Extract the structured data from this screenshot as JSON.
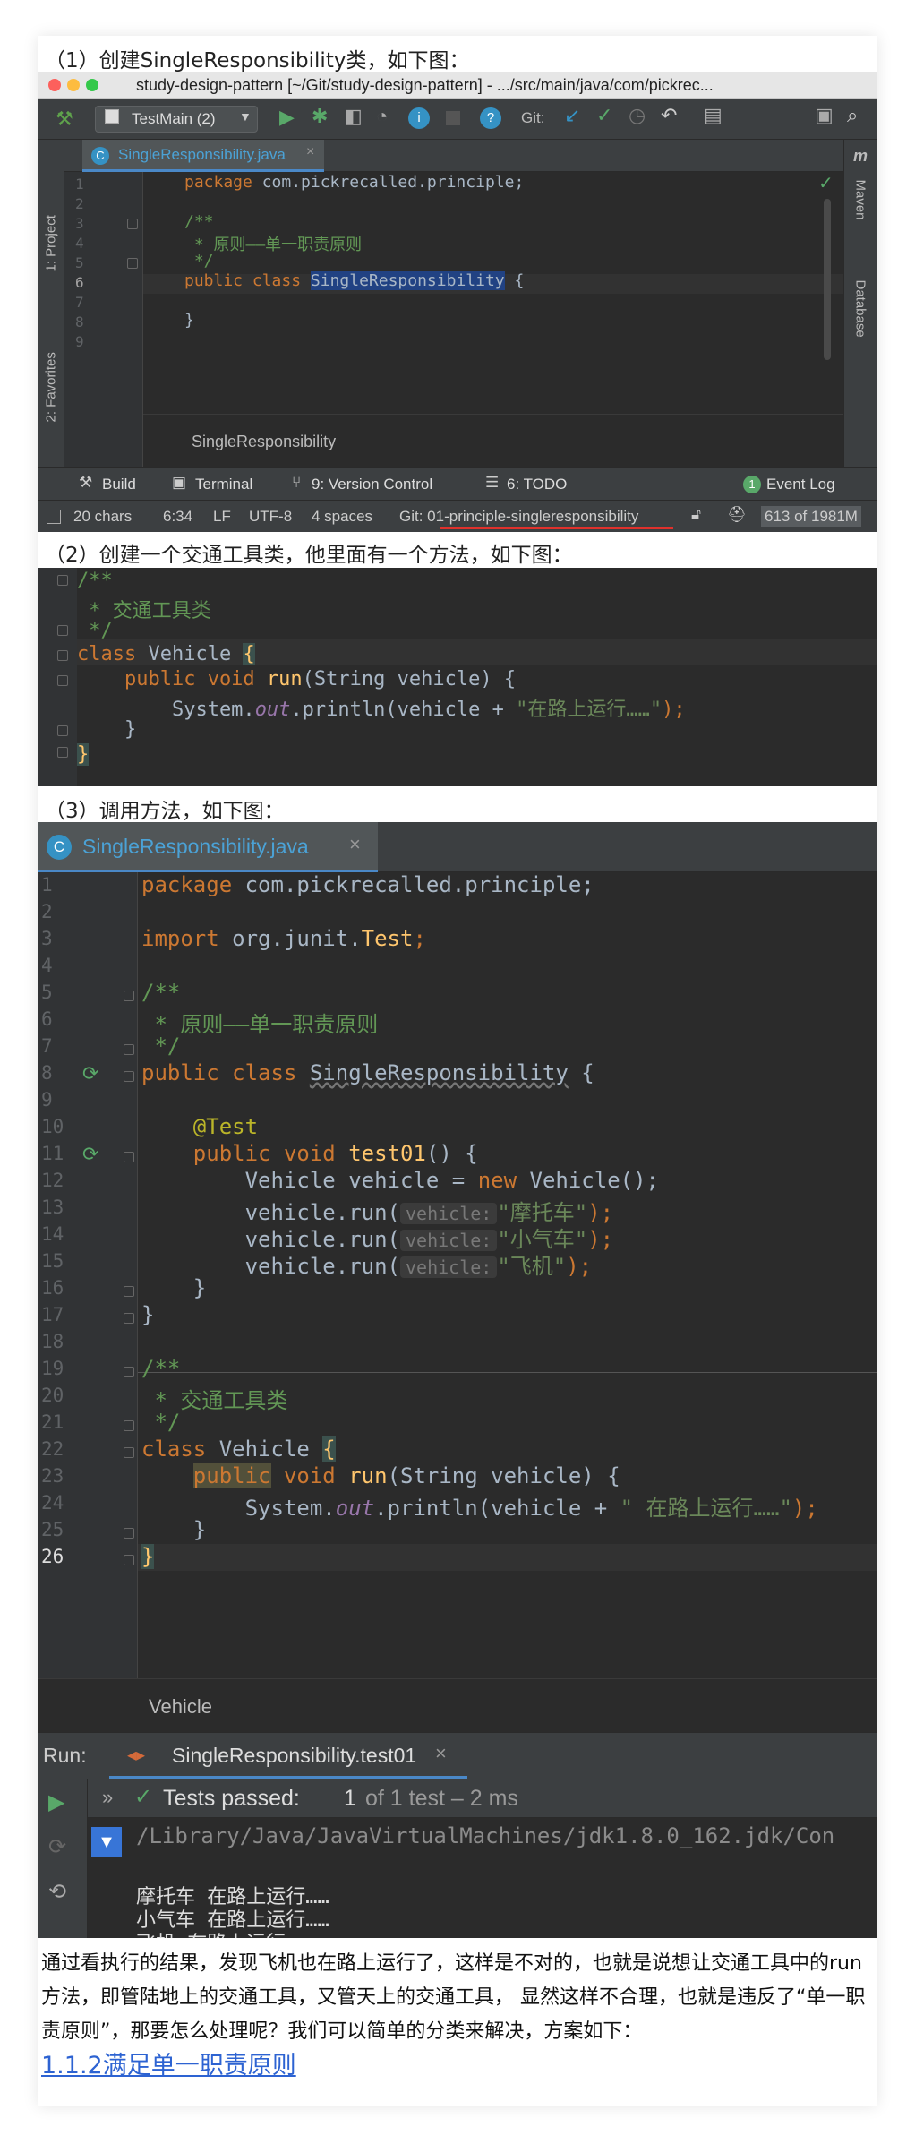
{
  "captions": {
    "s1": "（1）创建SingleResponsibility类，如下图：",
    "s2": "（2）创建一个交通工具类，他里面有一个方法，如下图：",
    "s3": "（3）调用方法，如下图："
  },
  "ide1": {
    "window_title": "study-design-pattern [~/Git/study-design-pattern] - .../src/main/java/com/pickrec...",
    "run_config": "TestMain (2)",
    "git_label": "Git:",
    "tab": "SingleResponsibility.java",
    "left_tools": [
      "1: Project",
      "2: Favorites"
    ],
    "right_tools": [
      "Maven",
      "Database"
    ],
    "breadcrumb": "SingleResponsibility",
    "bottom_tools": [
      "Build",
      "Terminal",
      "9: Version Control",
      "6: TODO"
    ],
    "event_log": "Event Log",
    "event_count": "1",
    "status": {
      "chars": "20 chars",
      "pos": "6:34",
      "le": "LF",
      "enc": "UTF-8",
      "indent": "4 spaces",
      "branch": "Git: 01-principle-singleresponsibility",
      "memory": "613 of 1981M"
    },
    "line_numbers": [
      "1",
      "2",
      "3",
      "4",
      "5",
      "6",
      "7",
      "8",
      "9"
    ],
    "code": {
      "l1a": "package",
      "l1b": " com.pickrecalled.principle;",
      "l3": "/**",
      "l4": " * 原则——单一职责原则",
      "l5": " */",
      "l6a": "public class ",
      "l6b": "SingleResponsibility",
      "l6c": " {",
      "l8": "}"
    }
  },
  "ide2": {
    "code": {
      "l1": "/**",
      "l2": " * 交通工具类",
      "l3": " */",
      "l4a": "class",
      "l4b": " Vehicle ",
      "l4c": "{",
      "l5a": "    public void ",
      "l5b": "run",
      "l5c": "(String vehicle) {",
      "l6a": "        System.",
      "l6b": "out",
      "l6c": ".println(vehicle + ",
      "l6d": "\"在路上运行……\"",
      "l6e": ");",
      "l7": "    }",
      "l8": "}"
    }
  },
  "ide3": {
    "tab": "SingleResponsibility.java",
    "line_numbers": [
      "1",
      "2",
      "3",
      "4",
      "5",
      "6",
      "7",
      "8",
      "9",
      "10",
      "11",
      "12",
      "13",
      "14",
      "15",
      "16",
      "17",
      "18",
      "19",
      "20",
      "21",
      "22",
      "23",
      "24",
      "25",
      "26"
    ],
    "code": {
      "l1a": "package",
      "l1b": " com.pickrecalled.principle;",
      "l3a": "import",
      "l3b": " org.junit.",
      "l3c": "Test",
      "l3d": ";",
      "l5": "/**",
      "l6": " * 原则——单一职责原则",
      "l7": " */",
      "l8a": "public class ",
      "l8b": "SingleResponsibility",
      "l8c": " {",
      "l10": "    @Test",
      "l11a": "    public void ",
      "l11b": "test01",
      "l11c": "() {",
      "l12a": "        Vehicle vehicle = ",
      "l12b": "new",
      "l12c": " Vehicle();",
      "run_call": "        vehicle.run(",
      "hint": "vehicle:",
      "l13s": "\"摩托车\"",
      "l14s": "\"小气车\"",
      "l15s": "\"飞机\"",
      "end_call": ");",
      "l16": "    }",
      "l17": "}",
      "l19": "/**",
      "l20": " * 交通工具类",
      "l21": " */",
      "l22a": "class",
      "l22b": " Vehicle ",
      "l22c": "{",
      "l23a": "public",
      "l23b": " void ",
      "l23c": "run",
      "l23d": "(String vehicle) {",
      "l24a": "        System.",
      "l24b": "out",
      "l24c": ".println(vehicle + ",
      "l24d": "\" 在路上运行……\"",
      "l24e": ");",
      "l25": "    }",
      "l26": "}"
    },
    "breadcrumb": "Vehicle",
    "run": {
      "label": "Run:",
      "tab": "SingleResponsibility.test01",
      "tests_passed": "Tests passed:",
      "count": "1",
      "of_text": "of 1 test – 2 ms",
      "path": "/Library/Java/JavaVirtualMachines/jdk1.8.0_162.jdk/Con",
      "out": [
        "摩托车 在路上运行……",
        "小气车 在路上运行……",
        "飞机 在路上运行……"
      ]
    }
  },
  "paragraph": "通过看执行的结果，发现飞机也在路上运行了，这样是不对的，也就是说想让交通工具中的run方法，即管陆地上的交通工具，又管天上的交通工具， 显然这样不合理，也就是违反了“单一职责原则”，那要怎么处理呢？我们可以简单的分类来解决，方案如下：",
  "link": "1.1.2满足单一职责原则",
  "colors": {
    "editor_bg": "#2b2b2b",
    "gutter_bg": "#313335",
    "toolbar_bg": "#3c3f41",
    "keyword": "#cc7832",
    "comment": "#629755",
    "string": "#6a8759",
    "function": "#ffc66d",
    "link": "#2d63d2"
  }
}
